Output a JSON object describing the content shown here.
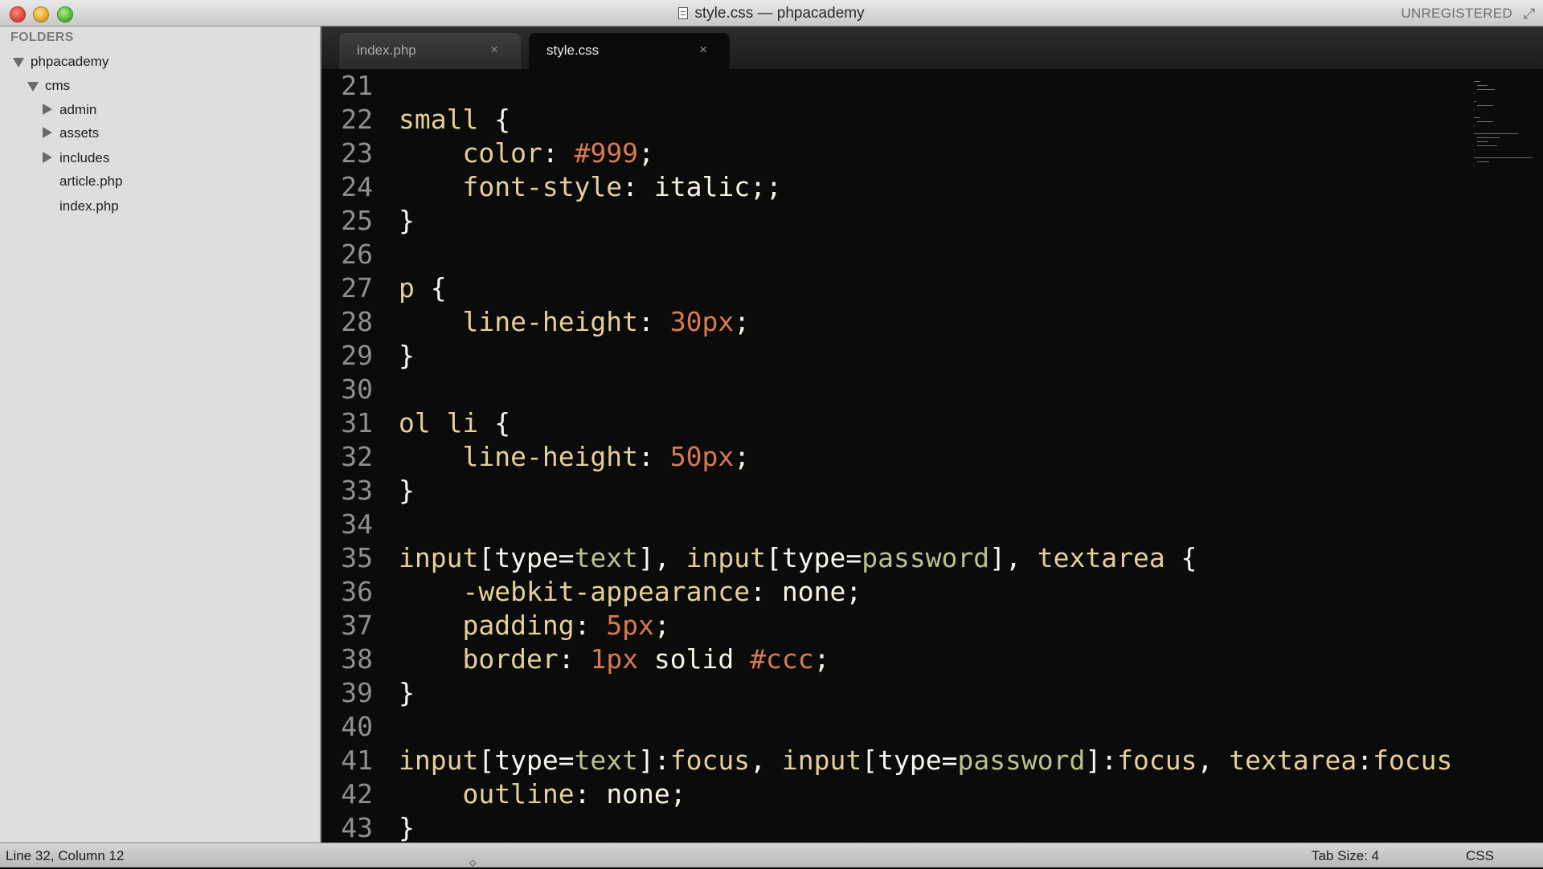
{
  "window": {
    "title": "style.css — phpacademy",
    "registration": "UNREGISTERED"
  },
  "sidebar": {
    "header": "FOLDERS",
    "tree": [
      {
        "label": "phpacademy",
        "type": "folder",
        "expanded": true,
        "depth": 0
      },
      {
        "label": "cms",
        "type": "folder",
        "expanded": true,
        "depth": 1
      },
      {
        "label": "admin",
        "type": "folder",
        "expanded": false,
        "depth": 2
      },
      {
        "label": "assets",
        "type": "folder",
        "expanded": false,
        "depth": 2
      },
      {
        "label": "includes",
        "type": "folder",
        "expanded": false,
        "depth": 2
      },
      {
        "label": "article.php",
        "type": "file",
        "depth": 2
      },
      {
        "label": "index.php",
        "type": "file",
        "depth": 2
      }
    ]
  },
  "tabs": [
    {
      "label": "index.php",
      "active": false,
      "close": "×"
    },
    {
      "label": "style.css",
      "active": true,
      "close": "×"
    }
  ],
  "editor": {
    "lines": [
      {
        "n": "21",
        "text": ""
      },
      {
        "n": "22",
        "text": "small {"
      },
      {
        "n": "23",
        "text": "    color: #999;"
      },
      {
        "n": "24",
        "text": "    font-style: italic;;"
      },
      {
        "n": "25",
        "text": "}"
      },
      {
        "n": "26",
        "text": ""
      },
      {
        "n": "27",
        "text": "p {"
      },
      {
        "n": "28",
        "text": "    line-height: 30px;"
      },
      {
        "n": "29",
        "text": "}"
      },
      {
        "n": "30",
        "text": ""
      },
      {
        "n": "31",
        "text": "ol li {"
      },
      {
        "n": "32",
        "text": "    line-height: 50px;"
      },
      {
        "n": "33",
        "text": "}"
      },
      {
        "n": "34",
        "text": ""
      },
      {
        "n": "35",
        "text": "input[type=text], input[type=password], textarea {"
      },
      {
        "n": "36",
        "text": "    -webkit-appearance: none;"
      },
      {
        "n": "37",
        "text": "    padding: 5px;"
      },
      {
        "n": "38",
        "text": "    border: 1px solid #ccc;"
      },
      {
        "n": "39",
        "text": "}"
      },
      {
        "n": "40",
        "text": ""
      },
      {
        "n": "41",
        "text": "input[type=text]:focus, input[type=password]:focus, textarea:focus"
      },
      {
        "n": "42",
        "text": "    outline: none;"
      },
      {
        "n": "43",
        "text": "}"
      }
    ]
  },
  "statusbar": {
    "position": "Line 32, Column 12",
    "tab_size": "Tab Size: 4",
    "syntax": "CSS"
  },
  "icons": {
    "close_window": "close-window-icon",
    "minimize_window": "minimize-window-icon",
    "zoom_window": "zoom-window-icon",
    "document": "document-icon",
    "fullscreen": "fullscreen-icon"
  },
  "colors": {
    "editor_bg": "#0b0b0b",
    "selector": "#e6cf99",
    "number": "#d87a4f",
    "attribute_value": "#b7c48e"
  }
}
